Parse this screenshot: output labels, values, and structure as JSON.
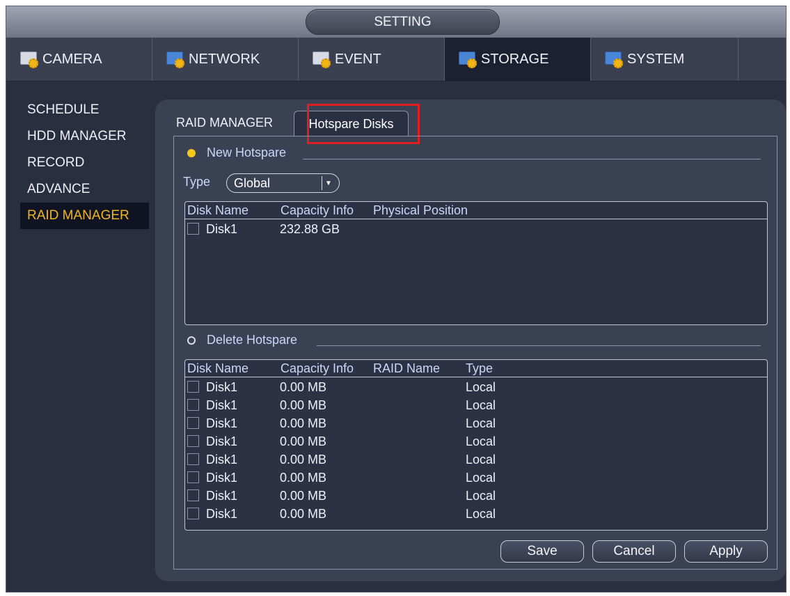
{
  "window": {
    "title": "SETTING"
  },
  "main_tabs": [
    {
      "label": "CAMERA",
      "icon": "camera-settings-icon"
    },
    {
      "label": "NETWORK",
      "icon": "network-settings-icon"
    },
    {
      "label": "EVENT",
      "icon": "event-settings-icon"
    },
    {
      "label": "STORAGE",
      "icon": "storage-settings-icon",
      "active": true
    },
    {
      "label": "SYSTEM",
      "icon": "system-settings-icon"
    }
  ],
  "left_menu": [
    {
      "label": "SCHEDULE"
    },
    {
      "label": "HDD MANAGER"
    },
    {
      "label": "RECORD"
    },
    {
      "label": "ADVANCE"
    },
    {
      "label": "RAID MANAGER",
      "active": true
    }
  ],
  "sub_tabs": {
    "raid_manager": "RAID MANAGER",
    "hotspare_disks": "Hotspare Disks"
  },
  "new_hotspare": {
    "label": "New Hotspare",
    "selected": true,
    "type_label": "Type",
    "type_value": "Global",
    "columns": [
      "Disk Name",
      "Capacity Info",
      "Physical Position"
    ],
    "rows": [
      {
        "disk": "Disk1",
        "capacity": "232.88 GB",
        "position": ""
      }
    ]
  },
  "delete_hotspare": {
    "label": "Delete Hotspare",
    "selected": false,
    "columns": [
      "Disk Name",
      "Capacity Info",
      "RAID Name",
      "Type"
    ],
    "rows": [
      {
        "disk": "Disk1",
        "capacity": "0.00 MB",
        "raid": "",
        "type": "Local"
      },
      {
        "disk": "Disk1",
        "capacity": "0.00 MB",
        "raid": "",
        "type": "Local"
      },
      {
        "disk": "Disk1",
        "capacity": "0.00 MB",
        "raid": "",
        "type": "Local"
      },
      {
        "disk": "Disk1",
        "capacity": "0.00 MB",
        "raid": "",
        "type": "Local"
      },
      {
        "disk": "Disk1",
        "capacity": "0.00 MB",
        "raid": "",
        "type": "Local"
      },
      {
        "disk": "Disk1",
        "capacity": "0.00 MB",
        "raid": "",
        "type": "Local"
      },
      {
        "disk": "Disk1",
        "capacity": "0.00 MB",
        "raid": "",
        "type": "Local"
      },
      {
        "disk": "Disk1",
        "capacity": "0.00 MB",
        "raid": "",
        "type": "Local"
      }
    ]
  },
  "buttons": {
    "save": "Save",
    "cancel": "Cancel",
    "apply": "Apply"
  },
  "colors": {
    "active_accent": "#f2b619",
    "highlight_box": "#e02020"
  }
}
